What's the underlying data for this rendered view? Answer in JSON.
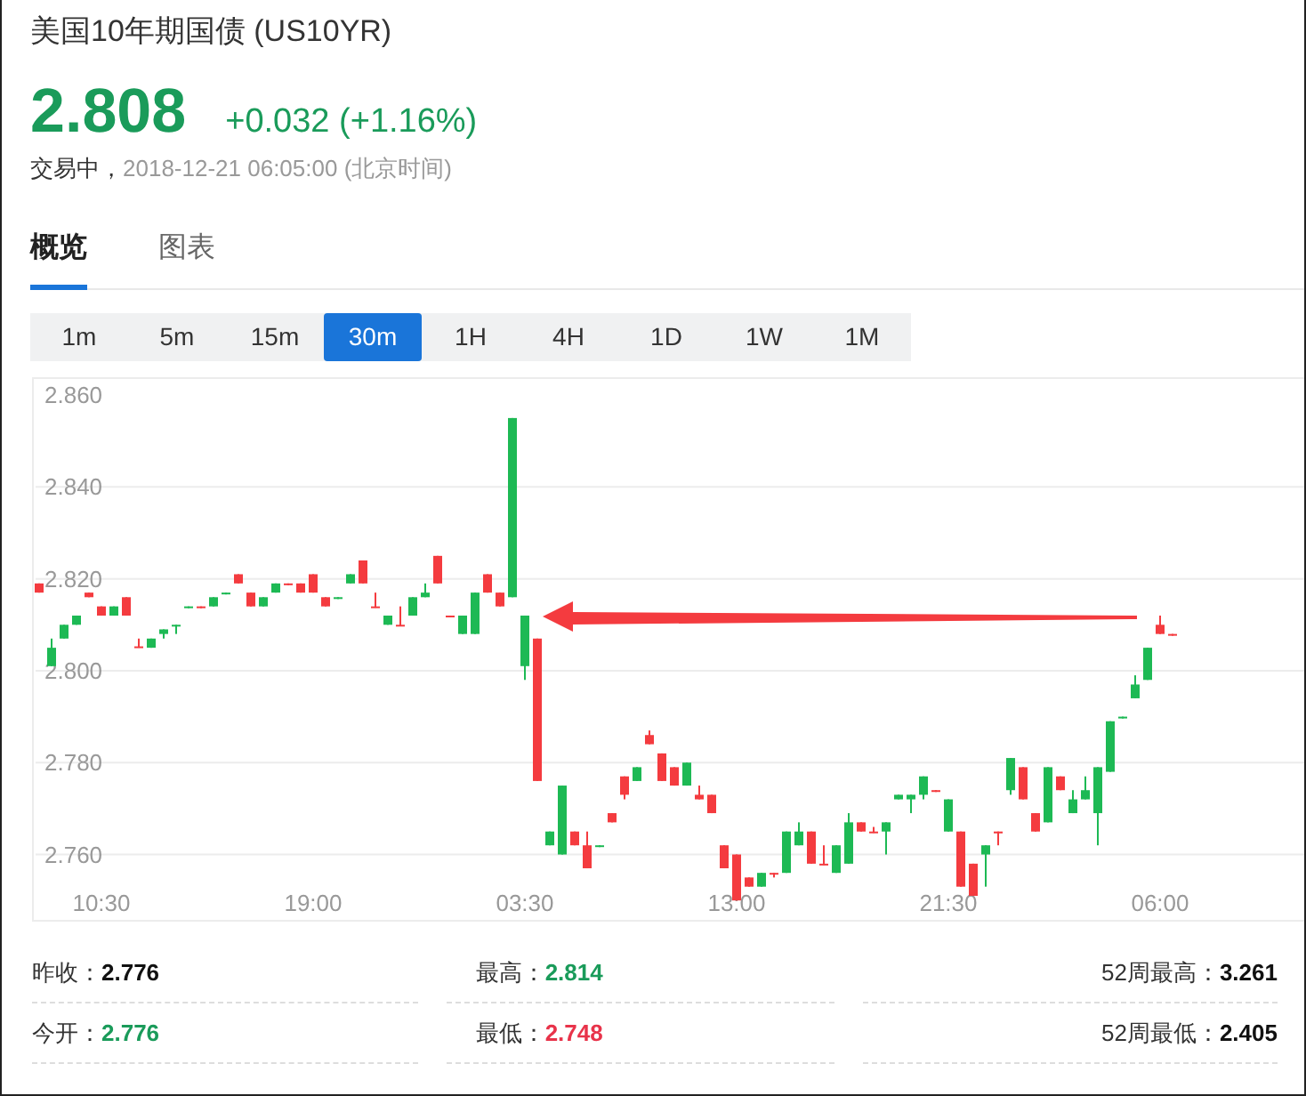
{
  "title": "美国10年期国债 (US10YR)",
  "price": "2.808",
  "change": "+0.032 (+1.16%)",
  "status": "交易中，",
  "timestamp": "2018-12-21 06:05:00 (北京时间)",
  "tabs": [
    {
      "label": "概览",
      "selected": true
    },
    {
      "label": "图表",
      "selected": false
    }
  ],
  "periods": [
    {
      "label": "1m",
      "selected": false
    },
    {
      "label": "5m",
      "selected": false
    },
    {
      "label": "15m",
      "selected": false
    },
    {
      "label": "30m",
      "selected": true
    },
    {
      "label": "1H",
      "selected": false
    },
    {
      "label": "4H",
      "selected": false
    },
    {
      "label": "1D",
      "selected": false
    },
    {
      "label": "1W",
      "selected": false
    },
    {
      "label": "1M",
      "selected": false
    }
  ],
  "chart": {
    "chart_data": {
      "type": "candlestick",
      "categories": [
        null,
        null,
        null,
        null,
        null,
        "10:30",
        null,
        null,
        null,
        null,
        null,
        null,
        null,
        null,
        null,
        null,
        null,
        null,
        null,
        null,
        null,
        null,
        "19:00",
        null,
        null,
        null,
        null,
        null,
        null,
        null,
        null,
        null,
        null,
        null,
        null,
        null,
        null,
        null,
        null,
        "03:30",
        null,
        null,
        null,
        null,
        null,
        null,
        null,
        null,
        null,
        null,
        null,
        null,
        null,
        null,
        null,
        null,
        "13:00",
        null,
        null,
        null,
        null,
        null,
        null,
        null,
        null,
        null,
        null,
        null,
        null,
        null,
        null,
        null,
        null,
        "21:30",
        null,
        null,
        null,
        null,
        null,
        null,
        null,
        null,
        null,
        null,
        null,
        null,
        null,
        null,
        null,
        null,
        "06:00",
        null
      ],
      "ohlc": [
        [
          2.819,
          2.819,
          2.817,
          2.817
        ],
        [
          2.801,
          2.807,
          2.801,
          2.805
        ],
        [
          2.807,
          2.81,
          2.807,
          2.81
        ],
        [
          2.81,
          2.812,
          2.81,
          2.812
        ],
        [
          2.817,
          2.817,
          2.816,
          2.816
        ],
        [
          2.814,
          2.814,
          2.812,
          2.812
        ],
        [
          2.812,
          2.814,
          2.812,
          2.814
        ],
        [
          2.816,
          2.816,
          2.812,
          2.812
        ],
        [
          2.8053,
          2.807,
          2.805,
          2.805
        ],
        [
          2.805,
          2.807,
          2.805,
          2.807
        ],
        [
          2.808,
          2.809,
          2.807,
          2.809
        ],
        [
          2.8097,
          2.81,
          2.808,
          2.81
        ],
        [
          2.8137,
          2.814,
          2.8137,
          2.814
        ],
        [
          2.814,
          2.814,
          2.8137,
          2.8137
        ],
        [
          2.814,
          2.816,
          2.814,
          2.816
        ],
        [
          2.8167,
          2.817,
          2.8167,
          2.817
        ],
        [
          2.821,
          2.821,
          2.819,
          2.819
        ],
        [
          2.817,
          2.817,
          2.814,
          2.814
        ],
        [
          2.814,
          2.816,
          2.814,
          2.816
        ],
        [
          2.817,
          2.819,
          2.817,
          2.819
        ],
        [
          2.819,
          2.819,
          2.8187,
          2.8187
        ],
        [
          2.819,
          2.819,
          2.817,
          2.817
        ],
        [
          2.821,
          2.821,
          2.817,
          2.817
        ],
        [
          2.816,
          2.816,
          2.814,
          2.814
        ],
        [
          2.8157,
          2.816,
          2.8157,
          2.816
        ],
        [
          2.819,
          2.821,
          2.819,
          2.821
        ],
        [
          2.824,
          2.824,
          2.819,
          2.819
        ],
        [
          2.814,
          2.817,
          2.8137,
          2.8137
        ],
        [
          2.81,
          2.812,
          2.81,
          2.812
        ],
        [
          2.81,
          2.814,
          2.8097,
          2.8097
        ],
        [
          2.812,
          2.816,
          2.812,
          2.816
        ],
        [
          2.816,
          2.819,
          2.816,
          2.817
        ],
        [
          2.825,
          2.825,
          2.819,
          2.819
        ],
        [
          2.812,
          2.812,
          2.8117,
          2.8117
        ],
        [
          2.808,
          2.812,
          2.808,
          2.812
        ],
        [
          2.808,
          2.817,
          2.808,
          2.817
        ],
        [
          2.821,
          2.821,
          2.817,
          2.817
        ],
        [
          2.817,
          2.817,
          2.814,
          2.814
        ],
        [
          2.816,
          2.855,
          2.816,
          2.855
        ],
        [
          2.801,
          2.812,
          2.798,
          2.812
        ],
        [
          2.807,
          2.807,
          2.776,
          2.776
        ],
        [
          2.762,
          2.765,
          2.762,
          2.765
        ],
        [
          2.76,
          2.775,
          2.76,
          2.775
        ],
        [
          2.765,
          2.765,
          2.762,
          2.762
        ],
        [
          2.762,
          2.765,
          2.757,
          2.757
        ],
        [
          2.7617,
          2.762,
          2.7617,
          2.762
        ],
        [
          2.769,
          2.769,
          2.767,
          2.767
        ],
        [
          2.777,
          2.777,
          2.772,
          2.773
        ],
        [
          2.776,
          2.779,
          2.776,
          2.779
        ],
        [
          2.786,
          2.787,
          2.784,
          2.784
        ],
        [
          2.782,
          2.782,
          2.776,
          2.776
        ],
        [
          2.779,
          2.779,
          2.775,
          2.775
        ],
        [
          2.775,
          2.78,
          2.775,
          2.78
        ],
        [
          2.773,
          2.775,
          2.772,
          2.772
        ],
        [
          2.773,
          2.773,
          2.769,
          2.769
        ],
        [
          2.762,
          2.762,
          2.757,
          2.757
        ],
        [
          2.76,
          2.76,
          2.75,
          2.75
        ],
        [
          2.755,
          2.755,
          2.753,
          2.753
        ],
        [
          2.753,
          2.756,
          2.753,
          2.756
        ],
        [
          2.756,
          2.756,
          2.755,
          2.7557
        ],
        [
          2.756,
          2.765,
          2.756,
          2.765
        ],
        [
          2.762,
          2.767,
          2.762,
          2.765
        ],
        [
          2.765,
          2.765,
          2.758,
          2.758
        ],
        [
          2.758,
          2.762,
          2.7577,
          2.7577
        ],
        [
          2.756,
          2.762,
          2.756,
          2.762
        ],
        [
          2.758,
          2.769,
          2.758,
          2.767
        ],
        [
          2.767,
          2.767,
          2.765,
          2.765
        ],
        [
          2.765,
          2.766,
          2.7647,
          2.7647
        ],
        [
          2.765,
          2.767,
          2.76,
          2.767
        ],
        [
          2.772,
          2.773,
          2.772,
          2.773
        ],
        [
          2.772,
          2.773,
          2.769,
          2.773
        ],
        [
          2.773,
          2.777,
          2.772,
          2.777
        ],
        [
          2.774,
          2.774,
          2.7737,
          2.7737
        ],
        [
          2.765,
          2.772,
          2.765,
          2.772
        ],
        [
          2.765,
          2.765,
          2.753,
          2.753
        ],
        [
          2.758,
          2.758,
          2.751,
          2.751
        ],
        [
          2.76,
          2.762,
          2.753,
          2.762
        ],
        [
          2.765,
          2.765,
          2.762,
          2.7646
        ],
        [
          2.774,
          2.781,
          2.773,
          2.781
        ],
        [
          2.779,
          2.779,
          2.772,
          2.772
        ],
        [
          2.769,
          2.769,
          2.765,
          2.765
        ],
        [
          2.767,
          2.779,
          2.767,
          2.779
        ],
        [
          2.777,
          2.777,
          2.774,
          2.774
        ],
        [
          2.769,
          2.774,
          2.769,
          2.772
        ],
        [
          2.772,
          2.777,
          2.772,
          2.774
        ],
        [
          2.769,
          2.779,
          2.762,
          2.779
        ],
        [
          2.778,
          2.789,
          2.778,
          2.789
        ],
        [
          2.7897,
          2.79,
          2.7897,
          2.79
        ],
        [
          2.794,
          2.799,
          2.794,
          2.797
        ],
        [
          2.798,
          2.805,
          2.798,
          2.805
        ],
        [
          2.81,
          2.812,
          2.808,
          2.808
        ],
        [
          2.808,
          2.808,
          2.8077,
          2.8077
        ]
      ],
      "ylim": [
        2.745,
        2.8635
      ],
      "grid": true,
      "yticks": [
        {
          "value": 2.86,
          "label": "2.860"
        },
        {
          "value": 2.84,
          "label": "2.840"
        },
        {
          "value": 2.82,
          "label": "2.820"
        },
        {
          "value": 2.8,
          "label": "2.800"
        },
        {
          "value": 2.78,
          "label": "2.780"
        },
        {
          "value": 2.76,
          "label": "2.760"
        }
      ]
    }
  },
  "stats": [
    {
      "label": "昨收：",
      "value": "2.776",
      "color": "#111111"
    },
    {
      "label": "最高：",
      "value": "2.814",
      "color": "#1a9b5a"
    },
    {
      "label": "52周最高：",
      "value": "3.261",
      "color": "#111111"
    },
    {
      "label": "今开：",
      "value": "2.776",
      "color": "#1a9b5a"
    },
    {
      "label": "最低：",
      "value": "2.748",
      "color": "#e8334a"
    },
    {
      "label": "52周最低：",
      "value": "2.405",
      "color": "#111111"
    }
  ]
}
